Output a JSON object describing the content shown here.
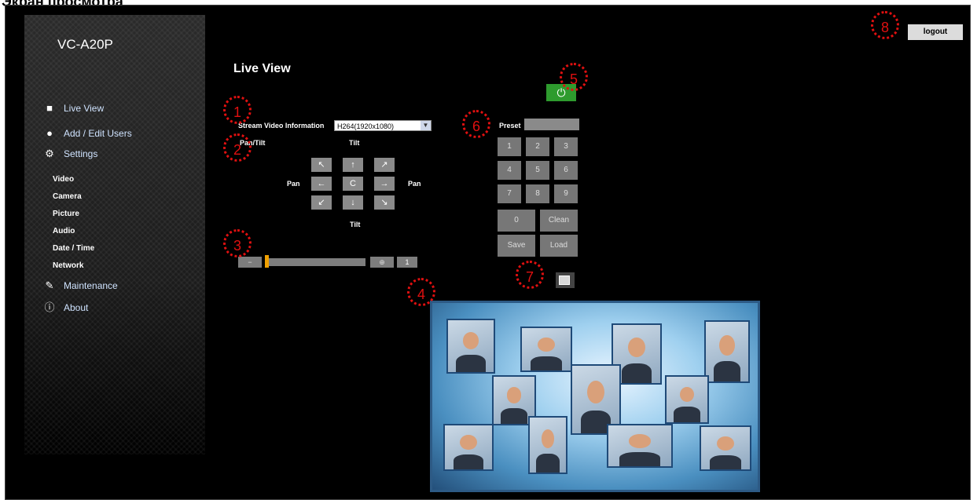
{
  "doc_title": "Экран просмотра",
  "app": {
    "model": "VC-A20P",
    "logout_label": "logout",
    "page_title": "Live View"
  },
  "sidebar": {
    "items": [
      {
        "label": "Live View",
        "icon": "camera-icon"
      },
      {
        "label": "Add / Edit Users",
        "icon": "user-icon"
      },
      {
        "label": "Settings",
        "icon": "gear-icon"
      },
      {
        "label": "Maintenance",
        "icon": "wrench-icon"
      },
      {
        "label": "About",
        "icon": "info-icon"
      }
    ],
    "settings_sub": [
      "Video",
      "Camera",
      "Picture",
      "Audio",
      "Date / Time",
      "Network"
    ]
  },
  "stream": {
    "label": "Stream Video Information",
    "selected": "H264(1920x1080)"
  },
  "ptz": {
    "pan_tilt_label": "Pan/Tilt",
    "tilt_label": "Tilt",
    "pan_label": "Pan",
    "buttons": [
      "↖",
      "↑",
      "↗",
      "←",
      "C",
      "→",
      "↙",
      "↓",
      "↘"
    ]
  },
  "zoom": {
    "level": "1",
    "level_fraction": 0.0
  },
  "preset": {
    "label": "Preset",
    "keys": [
      "1",
      "2",
      "3",
      "4",
      "5",
      "6",
      "7",
      "8",
      "9"
    ],
    "zero": "0",
    "clean": "Clean",
    "save": "Save",
    "load": "Load"
  },
  "markers": [
    "1",
    "2",
    "3",
    "4",
    "5",
    "6",
    "7",
    "8"
  ],
  "colors": {
    "background": "#000000",
    "power": "#2e9b2e",
    "marker": "#e01010",
    "zoom_thumb": "#f0a000"
  }
}
